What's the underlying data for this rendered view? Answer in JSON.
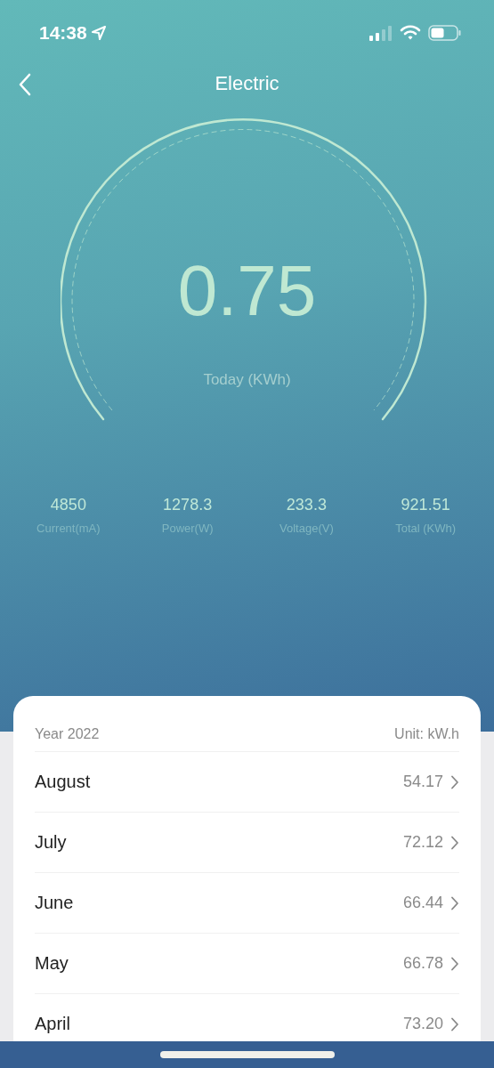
{
  "status_bar": {
    "time": "14:38"
  },
  "header": {
    "title": "Electric"
  },
  "gauge": {
    "value": "0.75",
    "caption": "Today (KWh)"
  },
  "stats": [
    {
      "value": "4850",
      "label": "Current(mA)"
    },
    {
      "value": "1278.3",
      "label": "Power(W)"
    },
    {
      "value": "233.3",
      "label": "Voltage(V)"
    },
    {
      "value": "921.51",
      "label": "Total (KWh)"
    }
  ],
  "monthly": {
    "year": "Year 2022",
    "unit": "Unit: kW.h",
    "rows": [
      {
        "month": "August",
        "value": "54.17"
      },
      {
        "month": "July",
        "value": "72.12"
      },
      {
        "month": "June",
        "value": "66.44"
      },
      {
        "month": "May",
        "value": "66.78"
      },
      {
        "month": "April",
        "value": "73.20"
      }
    ]
  }
}
